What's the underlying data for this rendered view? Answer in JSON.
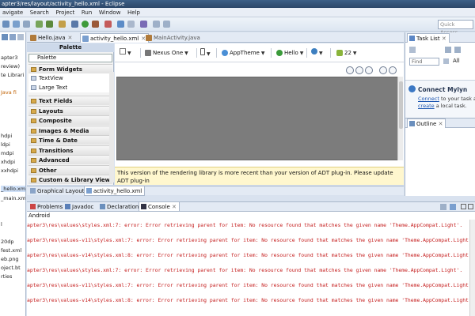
{
  "window": {
    "title": "apter3/res/layout/activity_hello.xml - Eclipse"
  },
  "menu": [
    "avigate",
    "Search",
    "Project",
    "Run",
    "Window",
    "Help"
  ],
  "quick_access": "Quick Access",
  "left_tree": [
    {
      "label": "apter3",
      "style": "normal"
    },
    {
      "label": "review)",
      "style": "normal"
    },
    {
      "label": "te Librari",
      "style": "normal"
    },
    {
      "label": "Java fi",
      "style": "orange"
    },
    {
      "label": "hdpi",
      "style": "normal"
    },
    {
      "label": "ldpi",
      "style": "normal"
    },
    {
      "label": "mdpi",
      "style": "normal"
    },
    {
      "label": "xhdpi",
      "style": "normal"
    },
    {
      "label": "xxhdpi",
      "style": "normal"
    },
    {
      "label": "_hello.xm",
      "style": "selected"
    },
    {
      "label": "_main.xm",
      "style": "normal"
    },
    {
      "label": "l",
      "style": "normal"
    },
    {
      "label": "20dp",
      "style": "normal"
    },
    {
      "label": "fest.xml",
      "style": "normal"
    },
    {
      "label": "eb.png",
      "style": "normal"
    },
    {
      "label": "oject.bt",
      "style": "normal"
    },
    {
      "label": "rties",
      "style": "normal"
    }
  ],
  "editor_tabs": [
    {
      "label": "Hello.java",
      "active": false
    },
    {
      "label": "activity_hello.xml",
      "active": true
    },
    {
      "label": "MainActivity.java",
      "active": false
    }
  ],
  "palette": {
    "header": "Palette",
    "combo": "Palette",
    "rows": [
      {
        "label": "Form Widgets",
        "kind": "cat"
      },
      {
        "label": "TextView",
        "kind": "item"
      },
      {
        "label": "Large Text",
        "kind": "item"
      },
      {
        "label": "Text Fields",
        "kind": "cat"
      },
      {
        "label": "Layouts",
        "kind": "cat"
      },
      {
        "label": "Composite",
        "kind": "cat"
      },
      {
        "label": "Images & Media",
        "kind": "cat"
      },
      {
        "label": "Time & Date",
        "kind": "cat"
      },
      {
        "label": "Transitions",
        "kind": "cat"
      },
      {
        "label": "Advanced",
        "kind": "cat"
      },
      {
        "label": "Other",
        "kind": "cat"
      },
      {
        "label": "Custom & Library Views",
        "kind": "cat"
      }
    ]
  },
  "canvas_toolbar": {
    "device": "Nexus One",
    "theme": "AppTheme",
    "activity": "Hello",
    "api": "22"
  },
  "warning": "This version of the rendering library is more recent than your version of ADT plug-in. Please update ADT plug-in",
  "sub_tabs": [
    "Graphical Layout",
    "activity_hello.xml"
  ],
  "right_panel": {
    "task_list_tab": "Task List",
    "find_placeholder": "Find",
    "find_scope": "All",
    "mylyn_title": "Connect Mylyn",
    "mylyn_connect": "Connect",
    "mylyn_text1": " to your task a",
    "mylyn_create": "create",
    "mylyn_text2": " a local task.",
    "outline_tab": "Outline"
  },
  "console_tabs": [
    "Problems",
    "Javadoc",
    "Declaration",
    "Console"
  ],
  "console_header": "Android",
  "console_lines": [
    "apter3\\res\\values\\styles.xml:7: error: Error retrieving parent for item: No resource found that matches the given name 'Theme.AppCompat.Light'.",
    "apter3\\res\\values-v11\\styles.xml:7: error: Error retrieving parent for item: No resource found that matches the given name 'Theme.AppCompat.Light'.",
    "apter3\\res\\values-v14\\styles.xml:8: error: Error retrieving parent for item: No resource found that matches the given name 'Theme.AppCompat.Light'.",
    "apter3\\res\\values\\styles.xml:7: error: Error retrieving parent for item: No resource found that matches the given name 'Theme.AppCompat.Light'.",
    "apter3\\res\\values-v11\\styles.xml:7: error: Error retrieving parent for item: No resource found that matches the given name 'Theme.AppCompat.Light'.",
    "apter3\\res\\values-v14\\styles.xml:8: error: Error retrieving parent for item: No resource found that matches the given name 'Theme.AppCompat.Light'."
  ]
}
